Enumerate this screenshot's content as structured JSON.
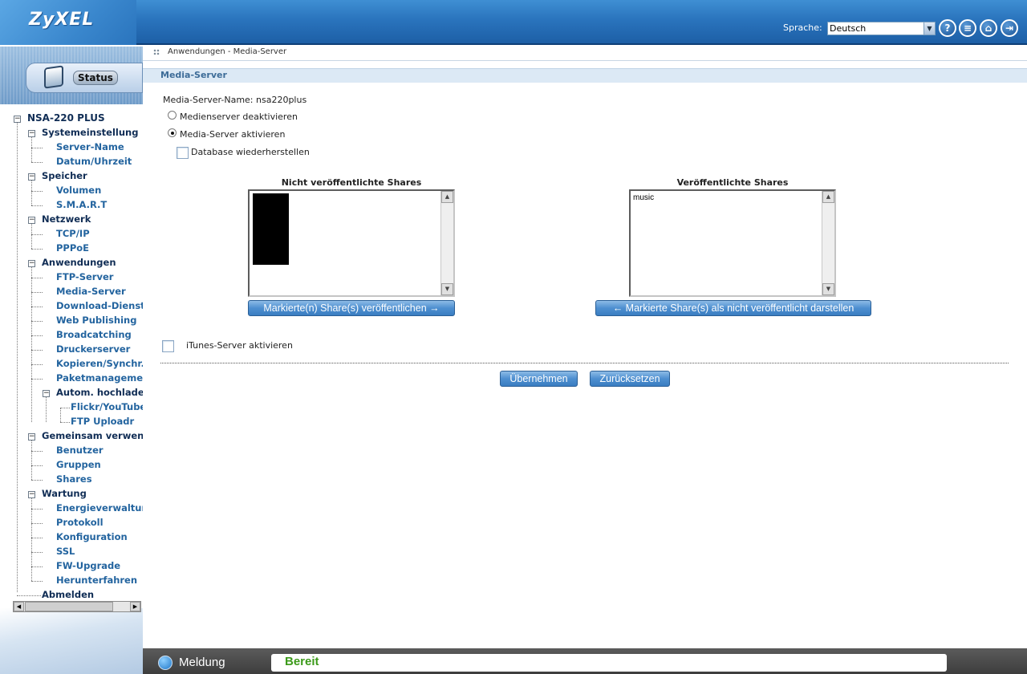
{
  "header": {
    "brand": "ZyXEL",
    "language_label": "Sprache:",
    "language_value": "Deutsch",
    "icons": [
      "help-icon",
      "notes-icon",
      "home-icon",
      "logout-icon"
    ]
  },
  "sidebar": {
    "status_tab": "Status",
    "tree": {
      "root": "NSA-220 PLUS",
      "systemeinstellung": "Systemeinstellung",
      "server_name": "Server-Name",
      "datum_uhrzeit": "Datum/Uhrzeit",
      "speicher": "Speicher",
      "volumen": "Volumen",
      "smart": "S.M.A.R.T",
      "netzwerk": "Netzwerk",
      "tcpip": "TCP/IP",
      "pppoe": "PPPoE",
      "anwendungen": "Anwendungen",
      "ftp_server": "FTP-Server",
      "media_server": "Media-Server",
      "download_dienst": "Download-Dienst",
      "web_publishing": "Web Publishing",
      "broadcatching": "Broadcatching",
      "druckerserver": "Druckerserver",
      "kopieren": "Kopieren/Synchr.-T",
      "paketmanagement": "Paketmanagement",
      "autom_hochladen": "Autom. hochladen",
      "flickr": "Flickr/YouTube",
      "ftp_uploadr": "FTP Uploadr",
      "gemeinsam": "Gemeinsam verwenden",
      "benutzer": "Benutzer",
      "gruppen": "Gruppen",
      "shares": "Shares",
      "wartung": "Wartung",
      "energie": "Energieverwaltung",
      "protokoll": "Protokoll",
      "konfiguration": "Konfiguration",
      "ssl": "SSL",
      "fw_upgrade": "FW-Upgrade",
      "herunterfahren": "Herunterfahren",
      "abmelden": "Abmelden"
    }
  },
  "main": {
    "breadcrumb": "Anwendungen - Media-Server",
    "section_title": "Media-Server",
    "server_name_line": "Media-Server-Name: nsa220plus",
    "radio_disable": "Medienserver deaktivieren",
    "radio_enable": "Media-Server aktivieren",
    "radio_selected": "enable",
    "restore_db": "Database wiederherstellen",
    "unpublished_title": "Nicht veröffentlichte Shares",
    "published_title": "Veröffentlichte Shares",
    "unpublished_items": [],
    "published_items": [
      "music"
    ],
    "publish_button": "Markierte(n) Share(s) veröffentlichen →",
    "unpublish_button": "← Markierte Share(s) als nicht veröffentlicht darstellen",
    "itunes_label": "iTunes-Server aktivieren",
    "apply_button": "Übernehmen",
    "reset_button": "Zurücksetzen"
  },
  "statusbar": {
    "label": "Meldung",
    "message": "Bereit",
    "message_color": "#3c9a1a"
  }
}
